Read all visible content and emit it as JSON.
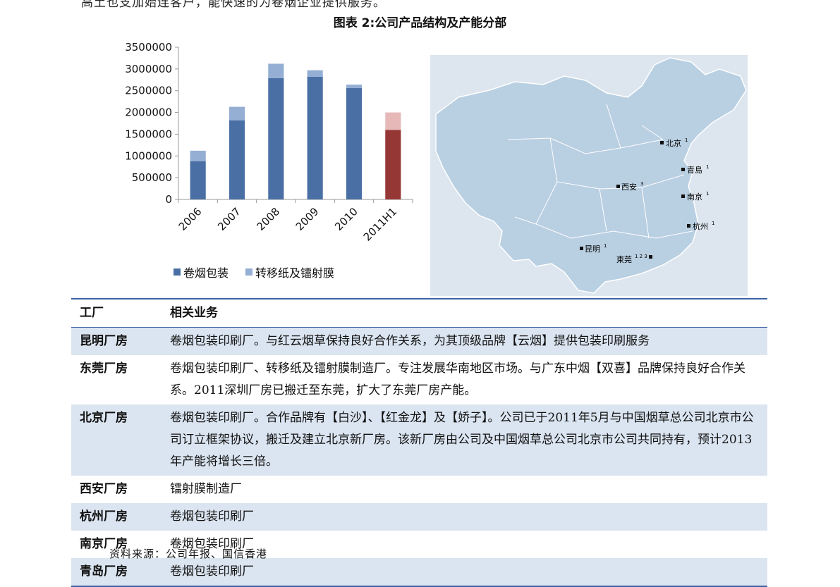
{
  "intro_line": "高土也支加始连客户，能快速的为卷烟企业提供服务。",
  "figure_title": "图表 2:公司产品结构及产能分部",
  "chart_data": {
    "type": "bar",
    "stacked": true,
    "categories": [
      "2006",
      "2007",
      "2008",
      "2009",
      "2010",
      "2011H1"
    ],
    "series": [
      {
        "name": "卷烟包装",
        "values": [
          880000,
          1820000,
          2790000,
          2820000,
          2560000,
          1600000
        ],
        "color": "#4a6fa5",
        "highlight_color": "#953735"
      },
      {
        "name": "转移纸及镭射膜",
        "values": [
          240000,
          310000,
          330000,
          150000,
          80000,
          400000
        ],
        "color": "#95aed4",
        "highlight_color": "#e6b9b8"
      }
    ],
    "highlight_category": "2011H1",
    "ylim": [
      0,
      3500000
    ],
    "yticks": [
      0,
      500000,
      1000000,
      1500000,
      2000000,
      2500000,
      3000000,
      3500000
    ],
    "grid": false,
    "legend_position": "bottom"
  },
  "map": {
    "cities": [
      {
        "name": "北京",
        "sup": "1"
      },
      {
        "name": "青島",
        "sup": "1"
      },
      {
        "name": "西安",
        "sup": "3"
      },
      {
        "name": "南京",
        "sup": "1"
      },
      {
        "name": "杭州",
        "sup": "1"
      },
      {
        "name": "昆明",
        "sup": "1"
      },
      {
        "name": "東莞",
        "sup": "1 2 3"
      }
    ]
  },
  "table": {
    "headers": [
      "工厂",
      "相关业务"
    ],
    "rows": [
      {
        "name": "昆明厂房",
        "desc": "卷烟包装印刷厂。与红云烟草保持良好合作关系，为其顶级品牌【云烟】提供包装印刷服务"
      },
      {
        "name": "东莞厂房",
        "desc": "卷烟包装印刷厂、转移纸及镭射膜制造厂。专注发展华南地区市场。与广东中烟【双喜】品牌保持良好合作关系。2011深圳厂房已搬迁至东莞，扩大了东莞厂房产能。"
      },
      {
        "name": "北京厂房",
        "desc": "卷烟包装印刷厂。合作品牌有【白沙】、【红金龙】及【娇子】。公司已于2011年5月与中国烟草总公司北京市公司订立框架协议，搬迁及建立北京新厂房。该新厂房由公司及中国烟草总公司北京市公司共同持有，预计2013年产能将增长三倍。"
      },
      {
        "name": "西安厂房",
        "desc": "镭射膜制造厂"
      },
      {
        "name": "杭州厂房",
        "desc": "卷烟包装印刷厂"
      },
      {
        "name": "南京厂房",
        "desc": "卷烟包装印刷厂"
      },
      {
        "name": "青岛厂房",
        "desc": "卷烟包装印刷厂"
      }
    ]
  },
  "source": "资料来源：公司年报、国信香港"
}
